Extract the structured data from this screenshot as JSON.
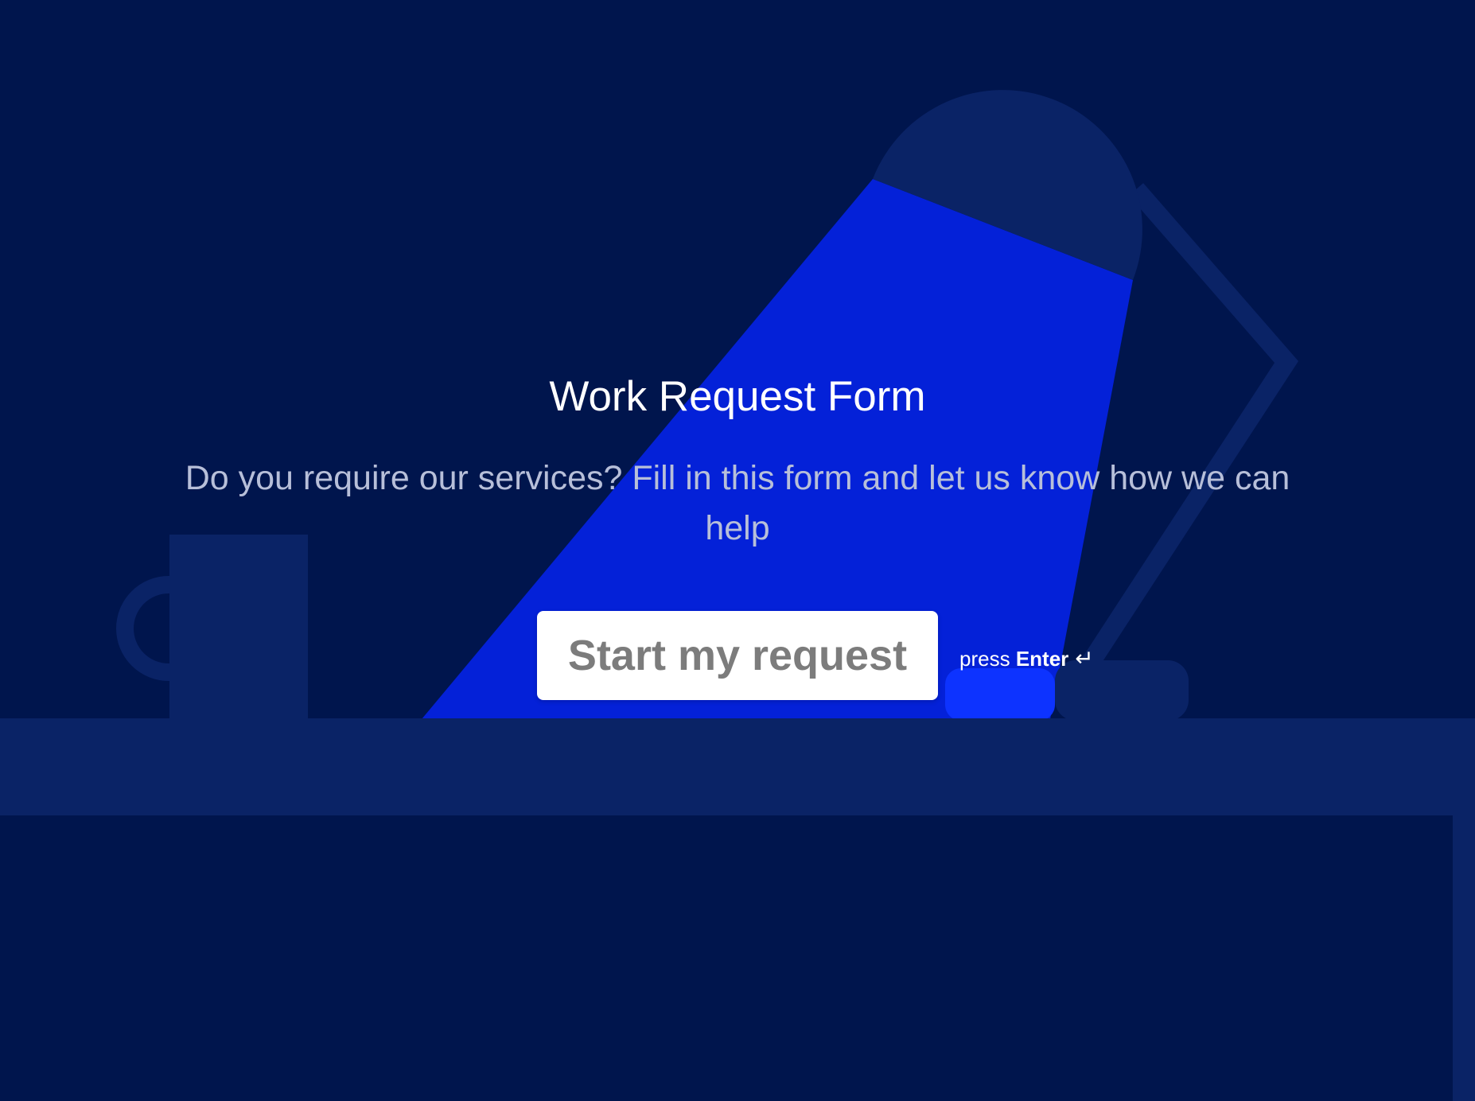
{
  "form": {
    "title": "Work Request Form",
    "subtitle": "Do you require our services? Fill in this form and let us know how we can help",
    "start_button_label": "Start my request",
    "hint_prefix": "press",
    "hint_key": "Enter",
    "hint_icon": "↵"
  },
  "colors": {
    "background": "#00154d",
    "scene_shapes": "#0a2366",
    "light_beam": "#0421d8",
    "light_glow": "#0d33ff",
    "title": "#ffffff",
    "subtitle": "#b7bfd9",
    "button_background": "#ffffff",
    "button_text": "#7c7c7c",
    "hint_text": "#ffffff"
  },
  "icons": {
    "enter_hint": "return-key-icon"
  }
}
